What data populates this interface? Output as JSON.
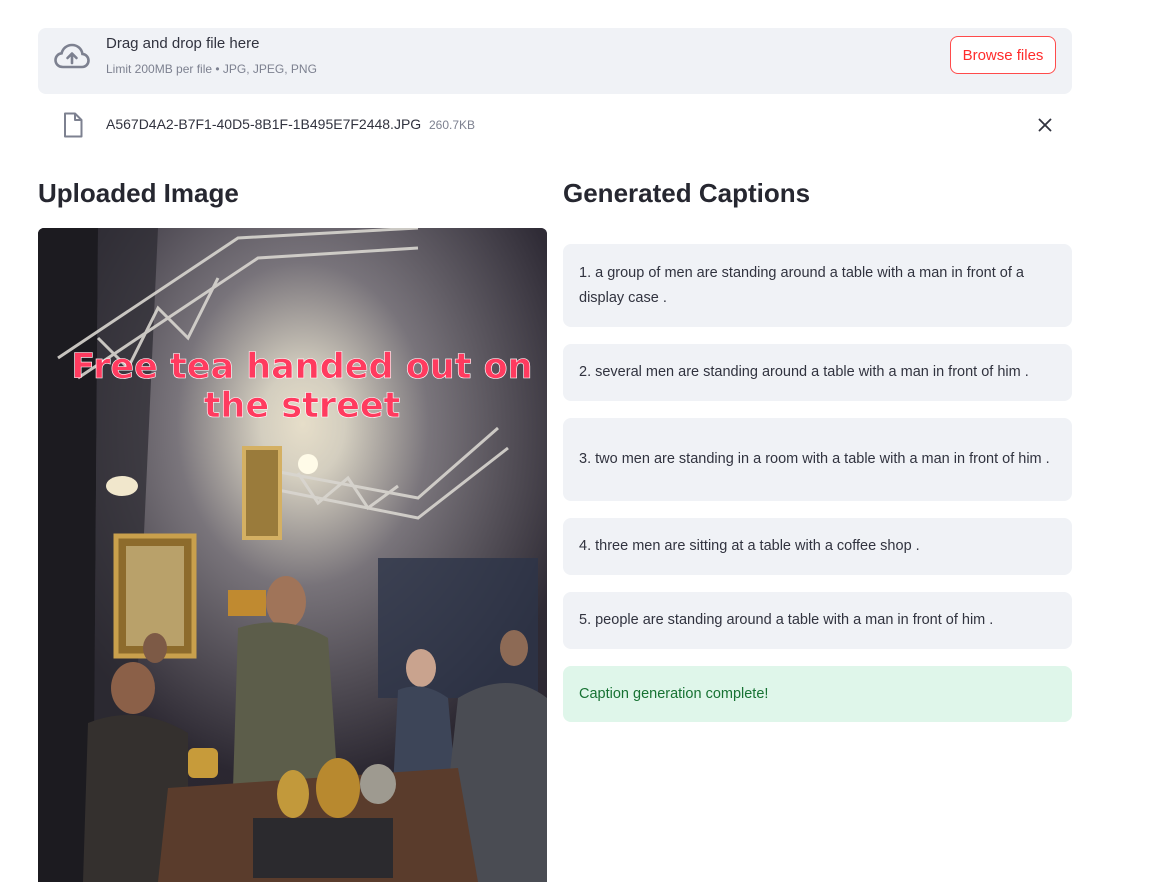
{
  "uploader": {
    "title": "Drag and drop file here",
    "subtitle": "Limit 200MB per file • JPG, JPEG, PNG",
    "browse_label": "Browse files",
    "icon": "cloud-upload-icon"
  },
  "file": {
    "name": "A567D4A2-B7F1-40D5-8B1F-1B495E7F2448.JPG",
    "size": "260.7KB",
    "icon": "file-icon",
    "remove_icon": "close-icon"
  },
  "left": {
    "heading": "Uploaded Image",
    "image_text_line1": "Free tea handed out on",
    "image_text_line2": "the street"
  },
  "right": {
    "heading": "Generated Captions",
    "captions": [
      "1. a group of men are standing around a table with a man in front of a display case .",
      "2. several men are standing around a table with a man in front of him .",
      "3. two men are standing in a room with a table with a man in front of him .",
      "4. three men are sitting at a table with a coffee shop .",
      "5. people are standing around a table with a man in front of him ."
    ],
    "status": "Caption generation complete!"
  },
  "colors": {
    "accent": "#ff4b4b",
    "panel": "#f0f2f6",
    "success_bg": "#dff6ea",
    "success_text": "#177233",
    "image_text": "#ff3b5f"
  }
}
